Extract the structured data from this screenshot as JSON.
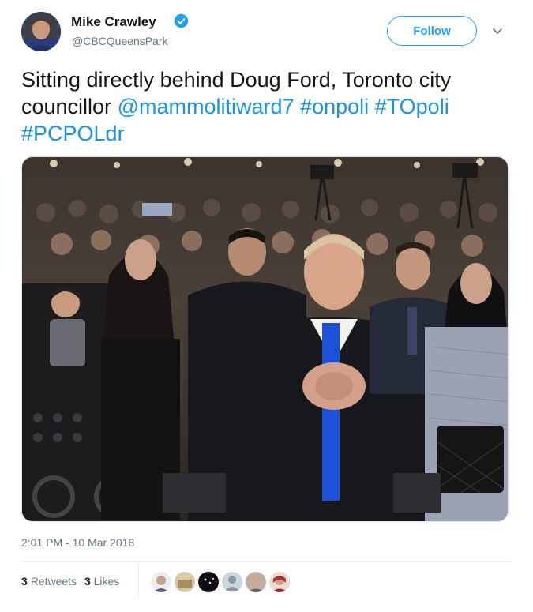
{
  "author": {
    "name": "Mike Crawley",
    "handle": "@CBCQueensPark",
    "verified": true
  },
  "actions": {
    "follow_label": "Follow",
    "menu_icon": "chevron-down-icon"
  },
  "tweet": {
    "text_plain": "Sitting directly behind Doug Ford, Toronto city councillor",
    "mention": "@mammolitiward7",
    "hashtags": [
      "#onpoli",
      "#TOpoli",
      "#PCPOLdr"
    ]
  },
  "meta": {
    "timestamp": "2:01 PM - 10 Mar 2018"
  },
  "stats": {
    "retweets_count": "3",
    "retweets_label": "Retweets",
    "likes_count": "3",
    "likes_label": "Likes"
  },
  "likers": [
    {
      "icon": "avatar-1"
    },
    {
      "icon": "avatar-2"
    },
    {
      "icon": "avatar-3"
    },
    {
      "icon": "avatar-default"
    },
    {
      "icon": "avatar-5"
    },
    {
      "icon": "avatar-6"
    }
  ],
  "colors": {
    "link": "#1b95e0",
    "accent": "#1da1f2",
    "muted": "#657786",
    "text": "#14171a"
  }
}
